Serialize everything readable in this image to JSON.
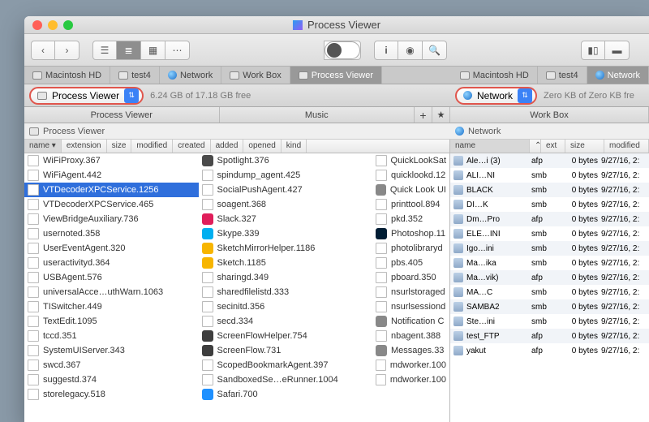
{
  "window": {
    "title": "Process Viewer"
  },
  "tabs_left": [
    {
      "label": "Macintosh HD",
      "icon": "disk"
    },
    {
      "label": "test4",
      "icon": "disk"
    },
    {
      "label": "Network",
      "icon": "globe"
    },
    {
      "label": "Work Box",
      "icon": "disk"
    },
    {
      "label": "Process Viewer",
      "icon": "disk",
      "active": true
    }
  ],
  "tabs_right": [
    {
      "label": "Macintosh HD",
      "icon": "disk"
    },
    {
      "label": "test4",
      "icon": "disk"
    },
    {
      "label": "Network",
      "icon": "globe",
      "active": true
    }
  ],
  "left_pill": {
    "label": "Process Viewer",
    "free": "6.24 GB of 17.18 GB free"
  },
  "right_pill": {
    "label": "Network",
    "free": "Zero KB of Zero KB fre"
  },
  "strip_left": [
    "Process Viewer",
    "Music"
  ],
  "strip_right": [
    "Work Box"
  ],
  "crumb_left": "Process Viewer",
  "crumb_right": "Network",
  "cols_left": [
    "name ▾",
    "extension",
    "size",
    "modified",
    "created",
    "added",
    "opened",
    "kind"
  ],
  "cols_right": [
    "name",
    "⌃",
    "ext",
    "size",
    "modified"
  ],
  "selected": "VTDecoderXPCService.1256",
  "colA": [
    "WiFiProxy.367",
    "WiFiAgent.442",
    "VTDecoderXPCService.1256",
    "VTDecoderXPCService.465",
    "ViewBridgeAuxiliary.736",
    "usernoted.358",
    "UserEventAgent.320",
    "useractivityd.364",
    "USBAgent.576",
    "universalAcce…uthWarn.1063",
    "TISwitcher.449",
    "TextEdit.1095",
    "tccd.351",
    "SystemUIServer.343",
    "swcd.367",
    "suggestd.374",
    "storelegacy.518"
  ],
  "colB": [
    {
      "n": "Spotlight.376",
      "i": "spot"
    },
    {
      "n": "spindump_agent.425",
      "i": "doc"
    },
    {
      "n": "SocialPushAgent.427",
      "i": "doc"
    },
    {
      "n": "soagent.368",
      "i": "doc"
    },
    {
      "n": "Slack.327",
      "i": "slack"
    },
    {
      "n": "Skype.339",
      "i": "skype"
    },
    {
      "n": "SketchMirrorHelper.1186",
      "i": "sketch"
    },
    {
      "n": "Sketch.1185",
      "i": "sketch"
    },
    {
      "n": "sharingd.349",
      "i": "doc"
    },
    {
      "n": "sharedfilelistd.333",
      "i": "doc"
    },
    {
      "n": "secinitd.356",
      "i": "doc"
    },
    {
      "n": "secd.334",
      "i": "doc"
    },
    {
      "n": "ScreenFlowHelper.754",
      "i": "sf"
    },
    {
      "n": "ScreenFlow.731",
      "i": "sf"
    },
    {
      "n": "ScopedBookmarkAgent.397",
      "i": "doc"
    },
    {
      "n": "SandboxedSe…eRunner.1004",
      "i": "doc"
    },
    {
      "n": "Safari.700",
      "i": "safari"
    }
  ],
  "colC": [
    "QuickLookSat",
    "quicklookd.12",
    "Quick Look UI",
    "printtool.894",
    "pkd.352",
    "Photoshop.11",
    "photolibraryd",
    "pbs.405",
    "pboard.350",
    "nsurlstoraged",
    "nsurlsessiond",
    "Notification C",
    "nbagent.388",
    "Messages.33",
    "mdworker.100",
    "mdworker.100"
  ],
  "netrows": [
    {
      "n": "Ale…i (3)",
      "e": "afp"
    },
    {
      "n": "ALI…NI",
      "e": "smb"
    },
    {
      "n": "BLACK",
      "e": "smb"
    },
    {
      "n": "DI…K",
      "e": "smb"
    },
    {
      "n": "Dm…Pro",
      "e": "afp"
    },
    {
      "n": "ELE…INI",
      "e": "smb"
    },
    {
      "n": "Igo…ini",
      "e": "smb"
    },
    {
      "n": "Ma…ika",
      "e": "smb"
    },
    {
      "n": "Ma…vik)",
      "e": "afp"
    },
    {
      "n": "MA…C",
      "e": "smb"
    },
    {
      "n": "SAMBA2",
      "e": "smb"
    },
    {
      "n": "Ste…ini",
      "e": "smb"
    },
    {
      "n": "test_FTP",
      "e": "afp"
    },
    {
      "n": "yakut",
      "e": "afp"
    }
  ],
  "size": "0 bytes",
  "date": "9/27/16, 2:"
}
